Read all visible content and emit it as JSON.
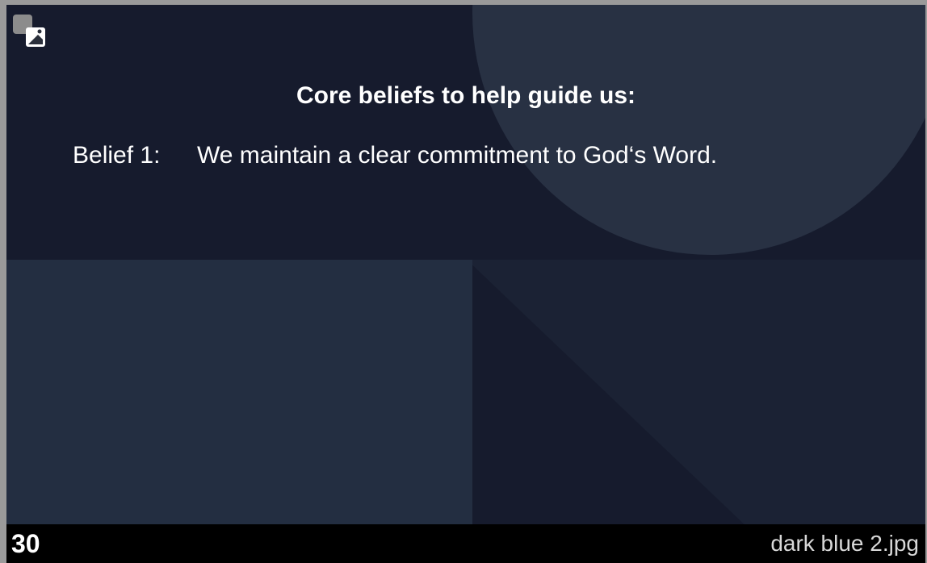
{
  "slide": {
    "title": "Core beliefs to help guide us:",
    "belief_label": "Belief 1:",
    "belief_text": "We maintain a clear commitment to God‘s Word.",
    "media_icon": "image-media-icon"
  },
  "footer": {
    "slide_number": "30",
    "file_name": "dark blue 2.jpg"
  },
  "colors": {
    "slide_background": "#161b2d",
    "circle": "#283143",
    "lower_left_panel": "#232e41",
    "footer_background": "#000000",
    "text": "#ffffff"
  }
}
